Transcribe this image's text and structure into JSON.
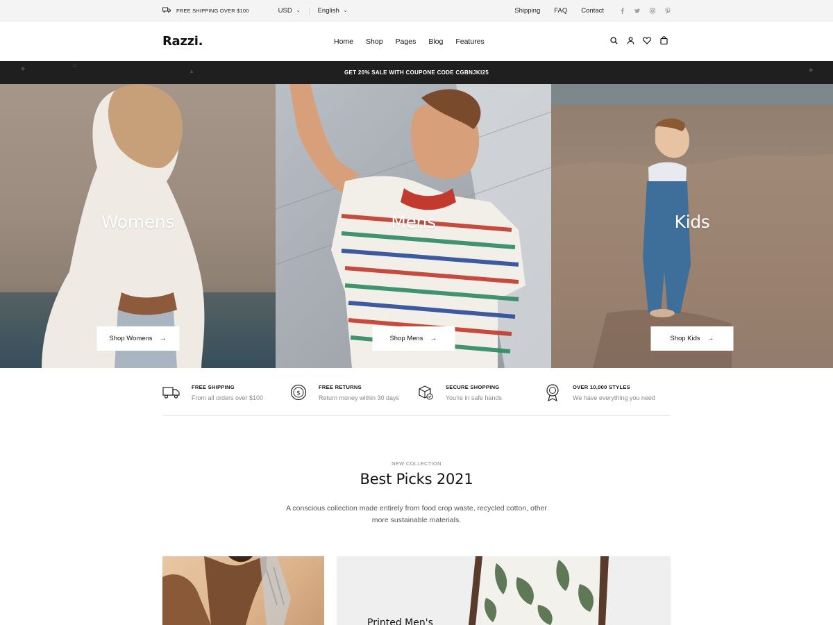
{
  "topbar": {
    "shipping_text": "FREE SHIPPING OVER $100",
    "currency": "USD",
    "language": "English",
    "links": [
      "Shipping",
      "FAQ",
      "Contact"
    ],
    "social_icons": [
      "facebook-icon",
      "twitter-icon",
      "instagram-icon",
      "pinterest-icon"
    ]
  },
  "header": {
    "logo": "Razzi.",
    "nav": [
      "Home",
      "Shop",
      "Pages",
      "Blog",
      "Features"
    ],
    "icons": [
      "search-icon",
      "user-icon",
      "heart-icon",
      "bag-icon"
    ]
  },
  "promo": {
    "text": "GET 20% SALE WITH COUPONE CODE CGBNJKI25"
  },
  "hero": {
    "panels": [
      {
        "title": "Womens",
        "button": "Shop Womens"
      },
      {
        "title": "Mens",
        "button": "Shop Mens"
      },
      {
        "title": "Kids",
        "button": "Shop Kids"
      }
    ]
  },
  "features": [
    {
      "icon": "truck-icon",
      "title": "FREE SHIPPING",
      "subtitle": "From all orders over $100"
    },
    {
      "icon": "coin-icon",
      "title": "FREE RETURNS",
      "subtitle": "Return money within 30 days"
    },
    {
      "icon": "box-check-icon",
      "title": "SECURE SHOPPING",
      "subtitle": "You're in safe hands"
    },
    {
      "icon": "badge-icon",
      "title": "OVER 10,000 STYLES",
      "subtitle": "We have everything you need"
    }
  ],
  "collection": {
    "eyebrow": "NEW COLLECTION",
    "title": "Best Picks 2021",
    "description": "A conscious collection made entirely from food crop waste, recycled cotton, other more sustainable materials."
  },
  "cards": {
    "second_title": "Printed Men's"
  },
  "colors": {
    "promo_bg": "#1f1f1f",
    "topbar_bg": "#f4f4f4",
    "text": "#111111",
    "muted": "#888888"
  }
}
